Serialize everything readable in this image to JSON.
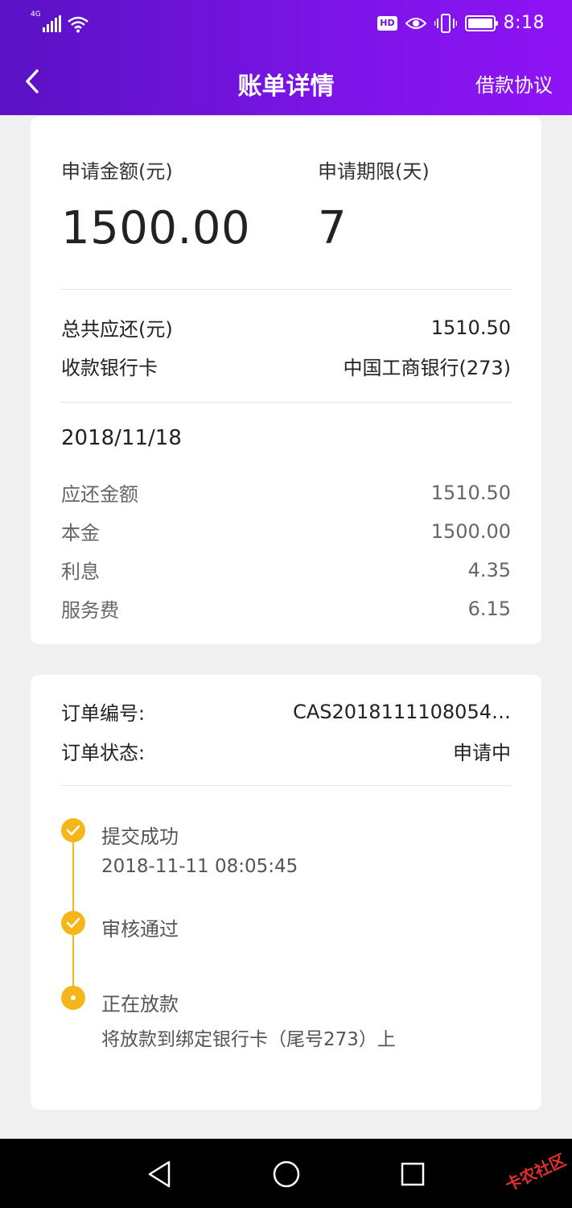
{
  "status_bar": {
    "network": "4G",
    "time": "8:18",
    "hd_label": "HD",
    "icons": [
      "signal-icon",
      "wifi-icon",
      "eye-icon",
      "vibrate-icon",
      "battery-icon"
    ]
  },
  "nav": {
    "title": "账单详情",
    "right_link": "借款协议",
    "back_icon": "chevron-left-icon"
  },
  "summary": {
    "amount_label": "申请金额(元)",
    "amount_value": "1500.00",
    "term_label": "申请期限(天)",
    "term_value": "7"
  },
  "totals": {
    "total_label": "总共应还(元)",
    "total_value": "1510.50",
    "bank_label": "收款银行卡",
    "bank_value": "中国工商银行(273)"
  },
  "schedule": {
    "date": "2018/11/18",
    "items": [
      {
        "label": "应还金额",
        "value": "1510.50"
      },
      {
        "label": "本金",
        "value": "1500.00"
      },
      {
        "label": "利息",
        "value": "4.35"
      },
      {
        "label": "服务费",
        "value": "6.15"
      }
    ]
  },
  "order": {
    "number_label": "订单编号:",
    "number_value": "CAS2018111108054…",
    "status_label": "订单状态:",
    "status_value": "申请中"
  },
  "timeline": [
    {
      "title": "提交成功",
      "sub": "2018-11-11 08:05:45",
      "state": "done"
    },
    {
      "title": "审核通过",
      "sub": "",
      "state": "done"
    },
    {
      "title": "正在放款",
      "sub": "将放款到绑定银行卡（尾号273）上",
      "state": "current"
    }
  ],
  "colors": {
    "header_start": "#5a12c4",
    "header_end": "#8f13f5",
    "timeline": "#f5b61c",
    "background": "#f0f0f0"
  },
  "bottom_nav": {
    "icons": [
      "back-triangle-icon",
      "home-circle-icon",
      "recents-square-icon"
    ]
  },
  "watermark": "卡农社区"
}
